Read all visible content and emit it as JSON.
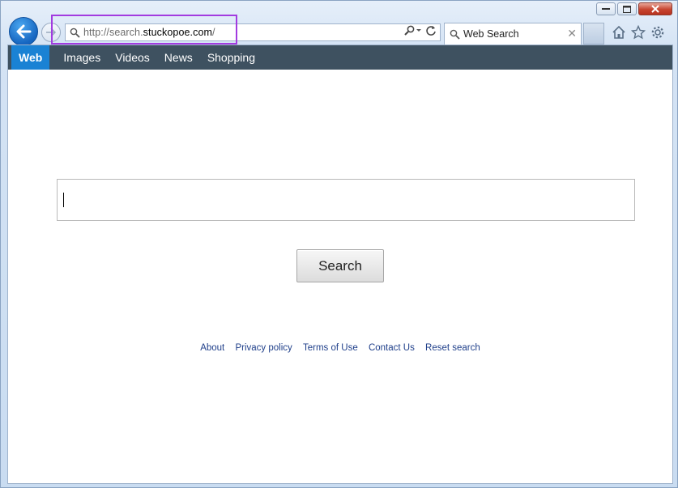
{
  "browser": {
    "address_bar": {
      "url_prefix": "http://search.",
      "url_domain": "stuckopoe.com",
      "url_suffix": "/"
    },
    "tab": {
      "title": "Web Search"
    },
    "icons": {
      "back": "back-arrow-icon",
      "forward": "forward-arrow-icon",
      "search": "search-icon",
      "refresh": "refresh-icon",
      "home": "home-icon",
      "favorites": "star-icon",
      "settings": "gear-icon"
    }
  },
  "nav": {
    "items": [
      {
        "label": "Web",
        "active": true
      },
      {
        "label": "Images"
      },
      {
        "label": "Videos"
      },
      {
        "label": "News"
      },
      {
        "label": "Shopping"
      }
    ]
  },
  "search": {
    "value": "",
    "button_label": "Search"
  },
  "footer": {
    "links": [
      "About",
      "Privacy policy",
      "Terms of Use",
      "Contact Us",
      "Reset search"
    ]
  },
  "colors": {
    "nav_bg": "#3e5160",
    "nav_active": "#1a82d4",
    "link": "#1f3f8a",
    "highlight_box": "#a23be0"
  }
}
